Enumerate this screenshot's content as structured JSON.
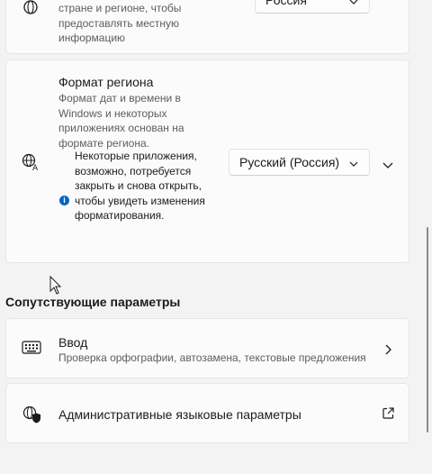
{
  "region_card": {
    "description": "стране и регионе, чтобы предоставлять местную информацию",
    "dropdown_value": "Россия"
  },
  "format_card": {
    "title": "Формат региона",
    "description": "Формат дат и времени в Windows и некоторых приложениях основан на формате региона.",
    "info_text": "Некоторые приложения, возможно, потребуется закрыть и снова открыть, чтобы увидеть изменения форматирования.",
    "dropdown_value": "Русский (Россия)"
  },
  "related": {
    "heading": "Сопутствующие параметры",
    "input": {
      "title": "Ввод",
      "subtitle": "Проверка орфографии, автозамена, текстовые предложения"
    },
    "admin": {
      "title": "Административные языковые параметры"
    }
  },
  "colors": {
    "accent": "#0067c0",
    "card_bg": "#fbfbfb",
    "page_bg": "#f3f3f3"
  },
  "icons": [
    "globe-icon",
    "region-format-icon",
    "info-icon",
    "chevron-down-icon",
    "keyboard-icon",
    "shield-globe-icon",
    "chevron-right-icon",
    "external-link-icon"
  ]
}
